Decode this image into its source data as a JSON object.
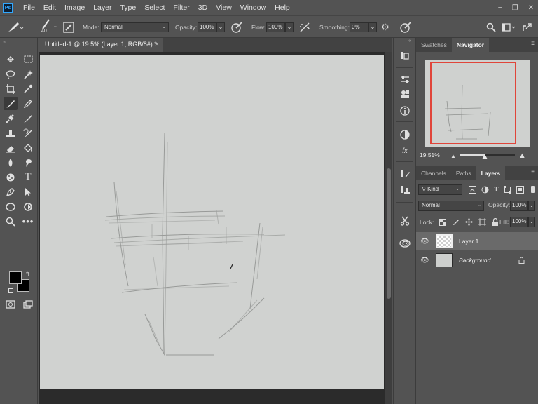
{
  "app": {
    "logo": "Ps"
  },
  "menu": [
    "File",
    "Edit",
    "Image",
    "Layer",
    "Type",
    "Select",
    "Filter",
    "3D",
    "View",
    "Window",
    "Help"
  ],
  "window_controls": {
    "minimize": "−",
    "restore": "❐",
    "close": "✕"
  },
  "options": {
    "brush_size": "40",
    "mode_label": "Mode:",
    "mode_value": "Normal",
    "opacity_label": "Opacity:",
    "opacity_value": "100%",
    "flow_label": "Flow:",
    "flow_value": "100%",
    "smoothing_label": "Smoothing:",
    "smoothing_value": "0%"
  },
  "document": {
    "tab_title": "Untitled-1 @ 19.5% (Layer 1, RGB/8#) *",
    "close": "×"
  },
  "navigator": {
    "tabs": [
      "Swatches",
      "Navigator"
    ],
    "active_tab": "Navigator",
    "zoom": "19.51%",
    "zoom_slider_fraction": 0.45
  },
  "layers_panel": {
    "tabs": [
      "Channels",
      "Paths",
      "Layers"
    ],
    "active_tab": "Layers",
    "filter_kind": "Kind",
    "blend_mode": "Normal",
    "opacity_label": "Opacity:",
    "opacity_value": "100%",
    "lock_label": "Lock:",
    "fill_label": "Fill:",
    "fill_value": "100%",
    "layers": [
      {
        "name": "Layer 1",
        "selected": true,
        "locked": false,
        "italic": false
      },
      {
        "name": "Background",
        "selected": false,
        "locked": true,
        "italic": true
      }
    ]
  },
  "colors": {
    "foreground": "#000000",
    "background": "#000000",
    "canvas": "#d0d2d0",
    "navigator_frame": "#e0453a"
  }
}
